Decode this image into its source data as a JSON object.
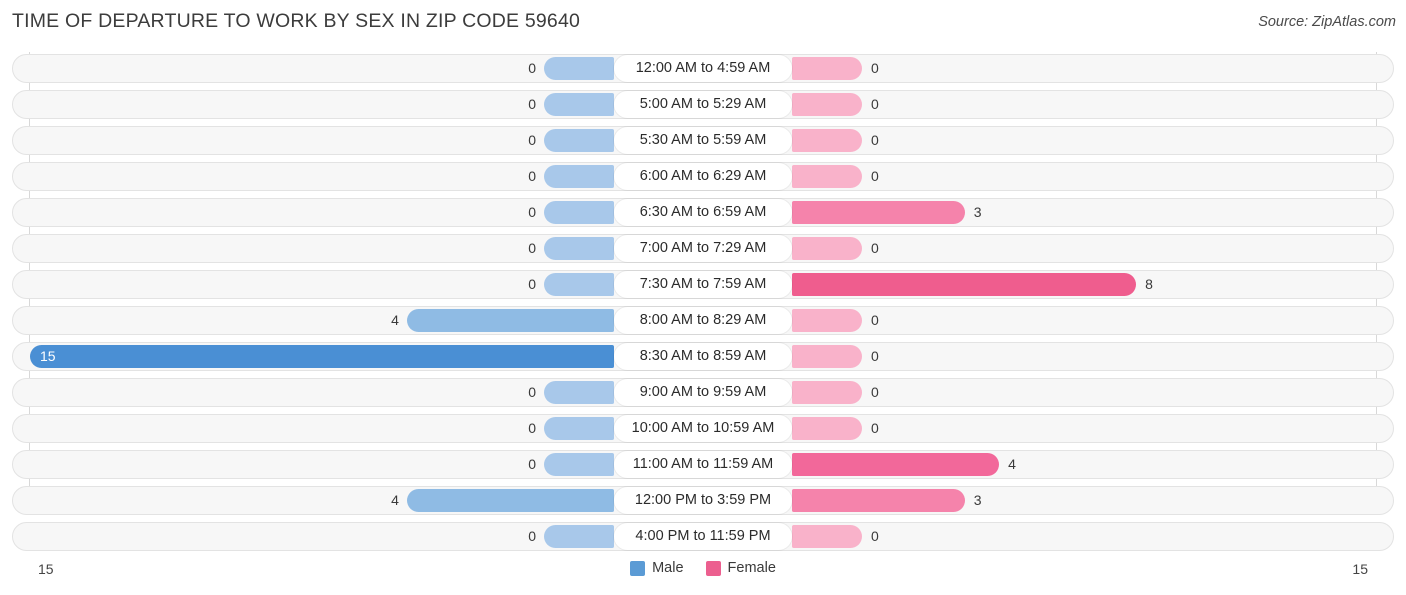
{
  "header": {
    "title": "TIME OF DEPARTURE TO WORK BY SEX IN ZIP CODE 59640",
    "source": "Source: ZipAtlas.com"
  },
  "legend": {
    "male_label": "Male",
    "female_label": "Female",
    "male_color": "#5b9bd5",
    "female_color": "#ec5f8f"
  },
  "axis": {
    "left_label": "15",
    "right_label": "15",
    "max": 15
  },
  "chart_data": {
    "type": "bar",
    "orientation": "horizontal-diverging",
    "title": "TIME OF DEPARTURE TO WORK BY SEX IN ZIP CODE 59640",
    "xlabel": "",
    "ylabel": "",
    "xlim": [
      15,
      15
    ],
    "grid": false,
    "legend_position": "bottom-center",
    "categories": [
      "12:00 AM to 4:59 AM",
      "5:00 AM to 5:29 AM",
      "5:30 AM to 5:59 AM",
      "6:00 AM to 6:29 AM",
      "6:30 AM to 6:59 AM",
      "7:00 AM to 7:29 AM",
      "7:30 AM to 7:59 AM",
      "8:00 AM to 8:29 AM",
      "8:30 AM to 8:59 AM",
      "9:00 AM to 9:59 AM",
      "10:00 AM to 10:59 AM",
      "11:00 AM to 11:59 AM",
      "12:00 PM to 3:59 PM",
      "4:00 PM to 11:59 PM"
    ],
    "series": [
      {
        "name": "Male",
        "values": [
          0,
          0,
          0,
          0,
          0,
          0,
          0,
          4,
          15,
          0,
          0,
          0,
          4,
          0
        ]
      },
      {
        "name": "Female",
        "values": [
          0,
          0,
          0,
          0,
          3,
          0,
          8,
          0,
          0,
          0,
          0,
          4,
          3,
          0
        ]
      }
    ]
  },
  "rows": [
    {
      "label": "12:00 AM to 4:59 AM",
      "male": "0",
      "female": "0"
    },
    {
      "label": "5:00 AM to 5:29 AM",
      "male": "0",
      "female": "0"
    },
    {
      "label": "5:30 AM to 5:59 AM",
      "male": "0",
      "female": "0"
    },
    {
      "label": "6:00 AM to 6:29 AM",
      "male": "0",
      "female": "0"
    },
    {
      "label": "6:30 AM to 6:59 AM",
      "male": "0",
      "female": "3"
    },
    {
      "label": "7:00 AM to 7:29 AM",
      "male": "0",
      "female": "0"
    },
    {
      "label": "7:30 AM to 7:59 AM",
      "male": "0",
      "female": "8"
    },
    {
      "label": "8:00 AM to 8:29 AM",
      "male": "4",
      "female": "0"
    },
    {
      "label": "8:30 AM to 8:59 AM",
      "male": "15",
      "female": "0"
    },
    {
      "label": "9:00 AM to 9:59 AM",
      "male": "0",
      "female": "0"
    },
    {
      "label": "10:00 AM to 10:59 AM",
      "male": "0",
      "female": "0"
    },
    {
      "label": "11:00 AM to 11:59 AM",
      "male": "0",
      "female": "4"
    },
    {
      "label": "12:00 PM to 3:59 PM",
      "male": "4",
      "female": "3"
    },
    {
      "label": "4:00 PM to 11:59 PM",
      "male": "0",
      "female": "0"
    }
  ]
}
